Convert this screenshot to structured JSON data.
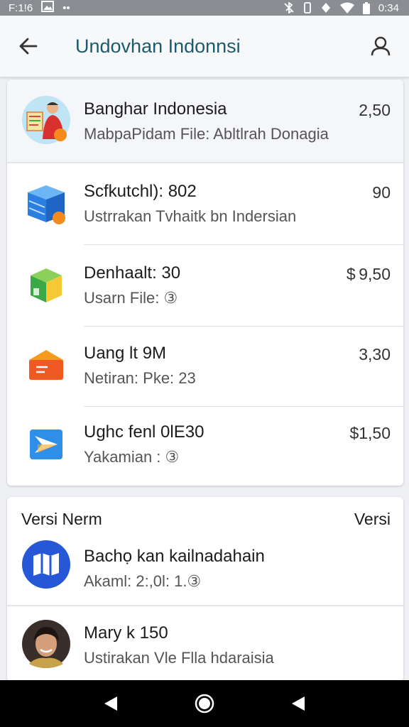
{
  "status_bar": {
    "time_left": "F:1!6",
    "dots": "••",
    "time_right": "0:34"
  },
  "app_bar": {
    "title": "Undovhan Indonnsi"
  },
  "list": [
    {
      "name": "Banghar Indonesia",
      "sub": "MabpaPidam File: Abltlrah Donagia",
      "price": "2,50",
      "icon": "person-illustration-icon"
    },
    {
      "name": "Scfkutchl): 802",
      "sub": "Ustrrakan Tvhaitk bn Indersian",
      "price": "90",
      "icon": "blue-database-icon"
    },
    {
      "name": "Denhaalt: 30",
      "sub": "Usarn File: ③",
      "price": "$ 9,50",
      "icon": "green-cube-icon"
    },
    {
      "name": "Uang lt 9M",
      "sub": "Netiran: Pke: 23",
      "price": "3,30",
      "icon": "orange-folder-icon"
    },
    {
      "name": "Ughc fenl  0lE30",
      "sub": "Yakamian : ③",
      "price": "$1,50",
      "icon": "blue-play-icon"
    }
  ],
  "section2": {
    "header_left": "Versi Nerm",
    "header_right": "Versi",
    "items": [
      {
        "name": "Bachọ kan kailnadahain",
        "sub": "Akaml: 2:,0l: 1.③",
        "icon": "blue-map-icon"
      },
      {
        "name": "Mary k 150",
        "sub": "Ustirakan Vle Flla hdaraisia",
        "icon": "woman-avatar-icon"
      }
    ]
  },
  "colors": {
    "accent": "#1d5a6a",
    "status_bar": "#8a8d92",
    "nav_bar": "#000000"
  }
}
